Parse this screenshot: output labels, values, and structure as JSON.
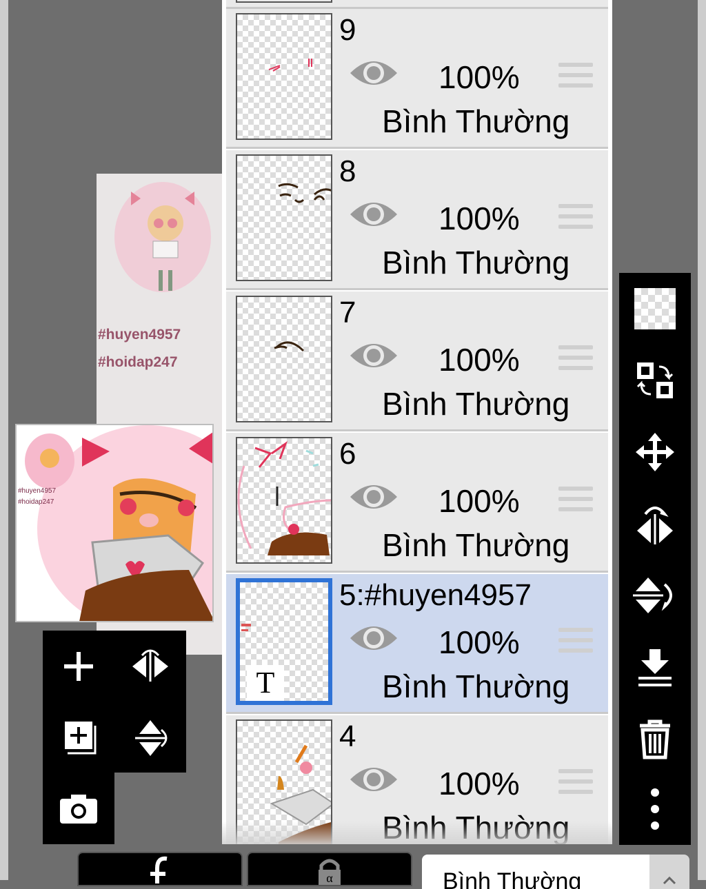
{
  "canvas_preview": {
    "tags": [
      "#huyen4957",
      "#hoidap247"
    ]
  },
  "thumbnail": {
    "tags": [
      "#huyen4957",
      "#hoidap247"
    ]
  },
  "left_tools": [
    {
      "name": "add-layer-button",
      "icon": "plus-icon"
    },
    {
      "name": "flip-horizontal-button",
      "icon": "flip-horizontal-icon"
    },
    {
      "name": "add-layer-copy-button",
      "icon": "add-copy-icon"
    },
    {
      "name": "flip-vertical-button",
      "icon": "flip-vertical-icon"
    },
    {
      "name": "camera-button",
      "icon": "camera-icon"
    }
  ],
  "layers": [
    {
      "name": "9",
      "opacity": "100%",
      "blend": "Bình Thường",
      "selected": false
    },
    {
      "name": "8",
      "opacity": "100%",
      "blend": "Bình Thường",
      "selected": false
    },
    {
      "name": "7",
      "opacity": "100%",
      "blend": "Bình Thường",
      "selected": false
    },
    {
      "name": "6",
      "opacity": "100%",
      "blend": "Bình Thường",
      "selected": false
    },
    {
      "name": "5:#huyen4957",
      "opacity": "100%",
      "blend": "Bình Thường",
      "selected": true,
      "text_layer_mark": "T"
    },
    {
      "name": "4",
      "opacity": "100%",
      "blend": "Bình Thường",
      "selected": false
    }
  ],
  "right_tools": [
    "transparency-icon",
    "swap-layer-icon",
    "move-icon",
    "flip-horizontal-icon",
    "flip-vertical-icon",
    "merge-down-icon",
    "trash-icon",
    "more-icon"
  ],
  "bottom_bar": {
    "blend_mode_value": "Bình Thường",
    "clip_icon": "clip-icon",
    "lock_icon": "lock-icon",
    "dropdown_icon": "chevron-up-icon"
  },
  "colors": {
    "selected_layer_bg": "#cdd8ee",
    "selected_border": "#2f73d6",
    "toolbar_bg": "#000000"
  }
}
